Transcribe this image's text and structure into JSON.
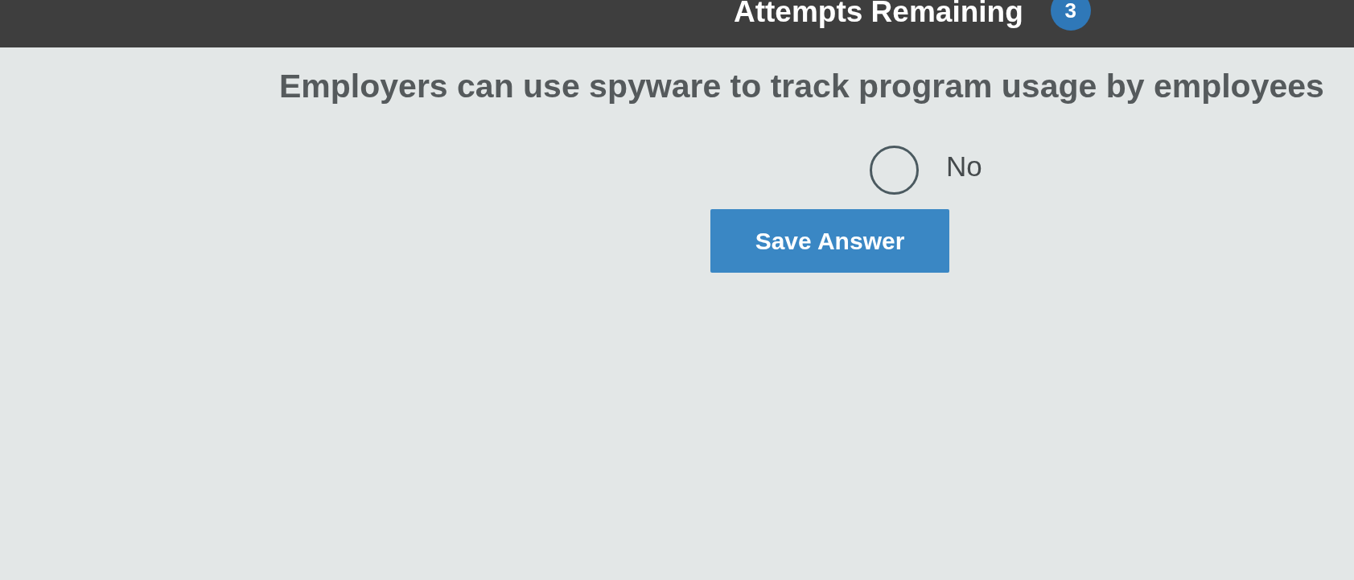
{
  "header": {
    "label": "Attempts Remaining",
    "count": "3"
  },
  "question": {
    "text": "Employers can use spyware to track program usage by employees"
  },
  "options": [
    {
      "label": "No",
      "selected": false
    }
  ],
  "buttons": [
    {
      "label": "Save Answer",
      "kind": "primary"
    }
  ]
}
